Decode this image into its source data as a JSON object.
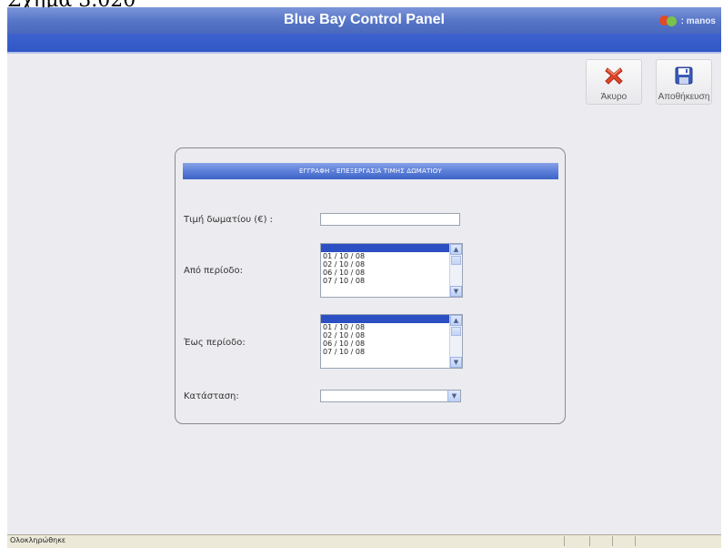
{
  "caption": "Σχήμα 3.020",
  "header": {
    "title": "Blue Bay Control Panel",
    "username": ": manos"
  },
  "toolbar": {
    "cancel_label": "Άκυρο",
    "save_label": "Αποθήκευση"
  },
  "form": {
    "heading": "ΕΓΓΡΑΦΗ - ΕΠΕΞΕΡΓΑΣΙΑ ΤΙΜΗΣ ΔΩΜΑΤΙΟΥ",
    "price_label": "Τιμή δωματίου (€) :",
    "price_value": "",
    "from_label": "Από περίοδο:",
    "from_options": [
      "",
      "01 / 10 / 08",
      "02 / 10 / 08",
      "06 / 10 / 08",
      "07 / 10 / 08"
    ],
    "to_label": "Έως περίοδο:",
    "to_options": [
      "",
      "01 / 10 / 08",
      "02 / 10 / 08",
      "06 / 10 / 08",
      "07 / 10 / 08"
    ],
    "status_label": "Κατάσταση:",
    "status_value": ""
  },
  "statusbar": {
    "text": "Ολοκληρώθηκε"
  },
  "colors": {
    "title_bar": "#5574c6",
    "nav_bar": "#3459c8",
    "selection": "#2d4fc4",
    "panel_background": "#ececf0"
  }
}
